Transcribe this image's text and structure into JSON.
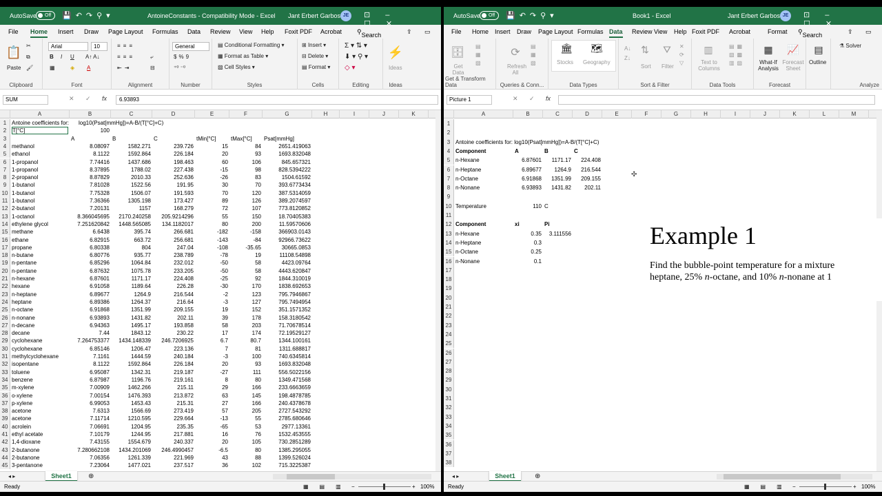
{
  "left": {
    "autosave": "AutoSave",
    "toggle": "Off",
    "title": "AntoineConstants - Compatibility Mode - Excel",
    "user": "Jant Erbert Garboso",
    "initials": "JE",
    "tabs": [
      "File",
      "Home",
      "Insert",
      "Draw",
      "Page Layout",
      "Formulas",
      "Data",
      "Review",
      "View",
      "Help",
      "Foxit PDF",
      "Acrobat"
    ],
    "search": "Search",
    "ribbon": {
      "paste": "Paste",
      "font_name": "Arial",
      "font_size": "10",
      "number_format": "General",
      "conditional": "Conditional Formatting",
      "format_table": "Format as Table",
      "cell_styles": "Cell Styles",
      "insert": "Insert",
      "delete": "Delete",
      "format": "Format",
      "ideas": "Ideas",
      "groups": [
        "Clipboard",
        "Font",
        "Alignment",
        "Number",
        "Styles",
        "Cells",
        "Editing",
        "Ideas"
      ]
    },
    "namebox": "SUM",
    "formula": "6.93893",
    "cols": [
      "A",
      "B",
      "C",
      "D",
      "E",
      "F",
      "G",
      "H",
      "I",
      "J",
      "K"
    ],
    "row1": "Antoine coefficients for:",
    "row1_formula": "log10(Psat[mmHg])=A-B/(T[°C]+C)",
    "row2_label": "T[°C]",
    "row2_value": "100",
    "row3": [
      "",
      "A",
      "B",
      "C",
      "tMin[°C]",
      "tMax[°C]",
      "Psat[mmHg]"
    ],
    "rows": [
      [
        "methanol",
        "8.08097",
        "1582.271",
        "239.726",
        "15",
        "84",
        "2651.419063"
      ],
      [
        "ethanol",
        "8.1122",
        "1592.864",
        "226.184",
        "20",
        "93",
        "1693.832048"
      ],
      [
        "1-propanol",
        "7.74416",
        "1437.686",
        "198.463",
        "60",
        "106",
        "845.657321"
      ],
      [
        "1-propanol",
        "8.37895",
        "1788.02",
        "227.438",
        "-15",
        "98",
        "828.5394222"
      ],
      [
        "2-propanol",
        "8.87829",
        "2010.33",
        "252.636",
        "-26",
        "83",
        "1504.61592"
      ],
      [
        "1-butanol",
        "7.81028",
        "1522.56",
        "191.95",
        "30",
        "70",
        "393.6773434"
      ],
      [
        "1-butanol",
        "7.75328",
        "1506.07",
        "191.593",
        "70",
        "120",
        "387.5314059"
      ],
      [
        "1-butanol",
        "7.36366",
        "1305.198",
        "173.427",
        "89",
        "126",
        "389.2074597"
      ],
      [
        "2-butanol",
        "7.20131",
        "1157",
        "168.279",
        "72",
        "107",
        "773.8120852"
      ],
      [
        "1-octanol",
        "8.366045695",
        "2170.240258",
        "205.9214296",
        "55",
        "150",
        "18.70405383"
      ],
      [
        "ethylene glycol",
        "7.251620842",
        "1448.565085",
        "134.1182017",
        "80",
        "200",
        "11.59570606"
      ],
      [
        "methane",
        "6.6438",
        "395.74",
        "266.681",
        "-182",
        "-158",
        "366903.0143"
      ],
      [
        "ethane",
        "6.82915",
        "663.72",
        "256.681",
        "-143",
        "-84",
        "92966.73622"
      ],
      [
        "propane",
        "6.80338",
        "804",
        "247.04",
        "-108",
        "-35.65",
        "30665.0853"
      ],
      [
        "n-butane",
        "6.80776",
        "935.77",
        "238.789",
        "-78",
        "19",
        "11108.54898"
      ],
      [
        "n-pentane",
        "6.85296",
        "1064.84",
        "232.012",
        "-50",
        "58",
        "4423.09764"
      ],
      [
        "n-pentane",
        "6.87632",
        "1075.78",
        "233.205",
        "-50",
        "58",
        "4443.620847"
      ],
      [
        "n-hexane",
        "6.87601",
        "1171.17",
        "224.408",
        "-25",
        "92",
        "1844.310019"
      ],
      [
        "hexane",
        "6.91058",
        "1189.64",
        "226.28",
        "-30",
        "170",
        "1838.692653"
      ],
      [
        "n-heptane",
        "6.89677",
        "1264.9",
        "216.544",
        "-2",
        "123",
        "795.7946867"
      ],
      [
        "heptane",
        "6.89386",
        "1264.37",
        "216.64",
        "-3",
        "127",
        "795.7494954"
      ],
      [
        "n-octane",
        "6.91868",
        "1351.99",
        "209.155",
        "19",
        "152",
        "351.1571352"
      ],
      [
        "n-nonane",
        "6.93893",
        "1431.82",
        "202.11",
        "39",
        "178",
        "158.3180542"
      ],
      [
        "n-decane",
        "6.94363",
        "1495.17",
        "193.858",
        "58",
        "203",
        "71.70678514"
      ],
      [
        "decane",
        "7.44",
        "1843.12",
        "230.22",
        "17",
        "174",
        "72.19529127"
      ],
      [
        "cyclohexane",
        "7.264753377",
        "1434.148339",
        "246.7206925",
        "6.7",
        "80.7",
        "1344.100161"
      ],
      [
        "cyclohexane",
        "6.85146",
        "1206.47",
        "223.136",
        "7",
        "81",
        "1311.688817"
      ],
      [
        "methylcyclohexane",
        "7.1161",
        "1444.59",
        "240.184",
        "-3",
        "100",
        "740.6345814"
      ],
      [
        "isopentane",
        "8.1122",
        "1592.864",
        "226.184",
        "20",
        "93",
        "1693.832048"
      ],
      [
        "toluene",
        "6.95087",
        "1342.31",
        "219.187",
        "-27",
        "111",
        "556.5022156"
      ],
      [
        "benzene",
        "6.87987",
        "1196.76",
        "219.161",
        "8",
        "80",
        "1349.471568"
      ],
      [
        "m-xylene",
        "7.00909",
        "1462.266",
        "215.11",
        "29",
        "166",
        "233.6663659"
      ],
      [
        "o-xylene",
        "7.00154",
        "1476.393",
        "213.872",
        "63",
        "145",
        "198.4878785"
      ],
      [
        "p-xylene",
        "6.99053",
        "1453.43",
        "215.31",
        "27",
        "166",
        "240.4378678"
      ],
      [
        "acetone",
        "7.6313",
        "1566.69",
        "273.419",
        "57",
        "205",
        "2727.543292"
      ],
      [
        "acetone",
        "7.11714",
        "1210.595",
        "229.664",
        "-13",
        "55",
        "2785.680646"
      ],
      [
        "acrolein",
        "7.06691",
        "1204.95",
        "235.35",
        "-65",
        "53",
        "2977.13361"
      ],
      [
        "ethyl acetate",
        "7.10179",
        "1244.95",
        "217.881",
        "16",
        "76",
        "1532.453555"
      ],
      [
        "1,4-dioxane",
        "7.43155",
        "1554.679",
        "240.337",
        "20",
        "105",
        "730.2851289"
      ],
      [
        "2-butanone",
        "7.280662108",
        "1434.201069",
        "246.4990457",
        "-6.5",
        "80",
        "1385.295055"
      ],
      [
        "2-butanone",
        "7.06356",
        "1261.339",
        "221.969",
        "43",
        "88",
        "1399.526024"
      ],
      [
        "3-pentanone",
        "7.23064",
        "1477.021",
        "237.517",
        "36",
        "102",
        "715.3225387"
      ]
    ],
    "sheet": "Sheet1",
    "status": "Ready",
    "zoom": "100%"
  },
  "right": {
    "autosave": "AutoSave",
    "toggle": "Off",
    "title": "Book1 - Excel",
    "user": "Jant Erbert Garboso",
    "initials": "JE",
    "tabs": [
      "File",
      "Home",
      "Insert",
      "Draw",
      "Page Layout",
      "Formulas",
      "Data",
      "Review",
      "View",
      "Help",
      "Foxit PDF",
      "Acrobat",
      "Format"
    ],
    "search": "Search",
    "ribbon": {
      "get_data": "Get Data",
      "refresh": "Refresh All",
      "stocks": "Stocks",
      "geography": "Geography",
      "sort": "Sort",
      "filter": "Filter",
      "text_to_columns": "Text to Columns",
      "whatif": "What-If Analysis",
      "forecast_sheet": "Forecast Sheet",
      "outline": "Outline",
      "solver": "Solver",
      "groups": [
        "Get & Transform Data",
        "Queries & Conn...",
        "Data Types",
        "Sort & Filter",
        "Data Tools",
        "Forecast",
        "Analyze"
      ]
    },
    "namebox": "Picture 1",
    "formula": "",
    "cols": [
      "A",
      "B",
      "C",
      "D",
      "E",
      "F",
      "G",
      "H",
      "I",
      "J",
      "K",
      "L",
      "M"
    ],
    "row_count": 38,
    "cells": [
      {
        "r": 3,
        "c": "A",
        "v": "Antoine coefficients for:  log10(Psat[mmHg])=A-B/(T[°C]+C)"
      },
      {
        "r": 4,
        "c": "A",
        "v": "Component",
        "b": true
      },
      {
        "r": 4,
        "c": "B",
        "v": "A",
        "b": true,
        "l": true
      },
      {
        "r": 4,
        "c": "C",
        "v": "B",
        "b": true,
        "l": true
      },
      {
        "r": 4,
        "c": "D",
        "v": "C",
        "b": true,
        "l": true
      },
      {
        "r": 5,
        "c": "A",
        "v": "n-Hexane"
      },
      {
        "r": 5,
        "c": "B",
        "v": "6.87601",
        "n": true
      },
      {
        "r": 5,
        "c": "C",
        "v": "1171.17",
        "n": true
      },
      {
        "r": 5,
        "c": "D",
        "v": "224.408",
        "n": true
      },
      {
        "r": 6,
        "c": "A",
        "v": "n-Heptane"
      },
      {
        "r": 6,
        "c": "B",
        "v": "6.89677",
        "n": true
      },
      {
        "r": 6,
        "c": "C",
        "v": "1264.9",
        "n": true
      },
      {
        "r": 6,
        "c": "D",
        "v": "216.544",
        "n": true
      },
      {
        "r": 7,
        "c": "A",
        "v": "n-Octane"
      },
      {
        "r": 7,
        "c": "B",
        "v": "6.91868",
        "n": true
      },
      {
        "r": 7,
        "c": "C",
        "v": "1351.99",
        "n": true
      },
      {
        "r": 7,
        "c": "D",
        "v": "209.155",
        "n": true
      },
      {
        "r": 8,
        "c": "A",
        "v": "n-Nonane"
      },
      {
        "r": 8,
        "c": "B",
        "v": "6.93893",
        "n": true
      },
      {
        "r": 8,
        "c": "C",
        "v": "1431.82",
        "n": true
      },
      {
        "r": 8,
        "c": "D",
        "v": "202.11",
        "n": true
      },
      {
        "r": 10,
        "c": "A",
        "v": "Temperature"
      },
      {
        "r": 10,
        "c": "B",
        "v": "110",
        "n": true
      },
      {
        "r": 10,
        "c": "C",
        "v": "C",
        "l": true
      },
      {
        "r": 12,
        "c": "A",
        "v": "Component",
        "b": true
      },
      {
        "r": 12,
        "c": "B",
        "v": "xi",
        "b": true,
        "l": true
      },
      {
        "r": 12,
        "c": "C",
        "v": "Pi",
        "b": true,
        "l": true
      },
      {
        "r": 13,
        "c": "A",
        "v": "n-Hexane"
      },
      {
        "r": 13,
        "c": "B",
        "v": "0.35",
        "n": true
      },
      {
        "r": 13,
        "c": "C",
        "v": "3.111556",
        "n": true
      },
      {
        "r": 14,
        "c": "A",
        "v": "n-Heptane"
      },
      {
        "r": 14,
        "c": "B",
        "v": "0.3",
        "n": true
      },
      {
        "r": 15,
        "c": "A",
        "v": "n-Octane"
      },
      {
        "r": 15,
        "c": "B",
        "v": "0.25",
        "n": true
      },
      {
        "r": 16,
        "c": "A",
        "v": "n-Nonane"
      },
      {
        "r": 16,
        "c": "B",
        "v": "0.1",
        "n": true
      }
    ],
    "example": {
      "title": "Example 1",
      "line1": "Find the bubble-point temperature for a mixture",
      "line2_a": "heptane, 25% ",
      "line2_b": "n",
      "line2_c": "-octane, and 10% ",
      "line2_d": "n",
      "line2_e": "-nonane at 1"
    },
    "sheet": "Sheet1",
    "status": "Ready",
    "zoom": "100%"
  }
}
